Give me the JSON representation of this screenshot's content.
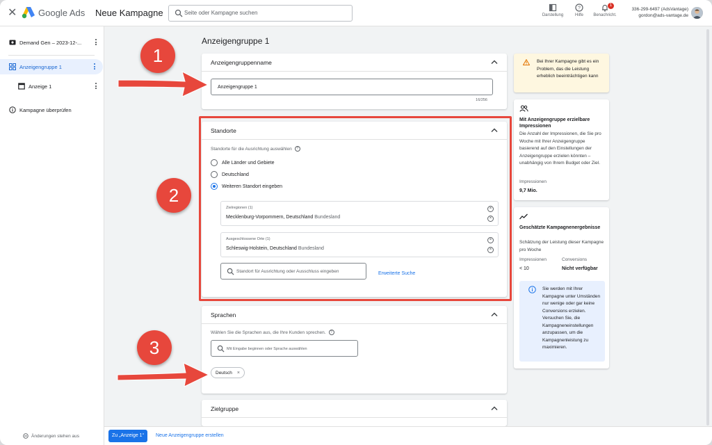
{
  "header": {
    "brand": "Google Ads",
    "title": "Neue Kampagne",
    "search_placeholder": "Seite oder Kampagne suchen",
    "icons": [
      {
        "name": "appearance-icon",
        "label": "Darstellung"
      },
      {
        "name": "help-icon",
        "label": "Hilfe"
      },
      {
        "name": "notifications-icon",
        "label": "Benachricht.",
        "badge": "1"
      }
    ],
    "account": {
      "line1": "336-299-6497 (AdsVantage)",
      "line2": "gordon@ads-vantage.de"
    }
  },
  "sidebar": {
    "items": [
      {
        "label": "Demand Gen – 2023-12-...",
        "icon": "campaign-icon"
      },
      {
        "label": "Anzeigengruppe 1",
        "icon": "grid-icon",
        "active": true
      },
      {
        "label": "Anzeige 1",
        "icon": "ad-icon"
      },
      {
        "label": "Kampagne überprüfen",
        "icon": "info-icon"
      }
    ],
    "footer": "Änderungen stehen aus"
  },
  "main": {
    "page_title": "Anzeigengruppe 1",
    "name_card": {
      "title": "Anzeigengruppenname",
      "value": "Anzeigengruppe 1",
      "counter": "16/256"
    },
    "locations_card": {
      "title": "Standorte",
      "label": "Standorte für die Ausrichtung auswählen",
      "options": [
        "Alle Länder und Gebiete",
        "Deutschland",
        "Weiteren Standort eingeben"
      ],
      "selected": 2,
      "target": {
        "caption": "Zielregionen (1)",
        "value": "Mecklenburg-Vorpommern, Deutschland",
        "type": "Bundesland"
      },
      "excluded": {
        "caption": "Ausgeschlossene Orte (1)",
        "value": "Schleswig-Holstein, Deutschland",
        "type": "Bundesland"
      },
      "search_placeholder": "Standort für Ausrichtung oder Ausschluss eingeben",
      "advanced_link": "Erweiterte Suche"
    },
    "languages_card": {
      "title": "Sprachen",
      "label": "Wählen Sie die Sprachen aus, die Ihre Kunden sprechen.",
      "search_placeholder": "Mit Eingabe beginnen oder Sprache auswählen",
      "chip": "Deutsch"
    },
    "audience_card": {
      "title": "Zielgruppe"
    }
  },
  "right_panel": {
    "warning": "Bei Ihrer Kampagne gibt es ein Problem, das die Leistung erheblich beeinträchtigen kann",
    "impressions_card": {
      "title": "Mit Anzeigengruppe erzielbare Impressionen",
      "text": "Die Anzahl der Impressionen, die Sie pro Woche mit Ihrer Anzeigengruppe basierend auf den Einstellungen der Anzeigengruppe erzielen könnten – unabhängig von Ihrem Budget oder Ziel.",
      "metric_label": "Impressionen",
      "metric_value": "9,7 Mio."
    },
    "results_card": {
      "title": "Geschätzte Kampagnenergebnisse",
      "text": "Schätzung der Leistung dieser Kampagne pro Woche",
      "impr_label": "Impressionen",
      "impr_value": "< 10",
      "conv_label": "Conversions",
      "conv_value": "Nicht verfügbar",
      "info": "Sie werden mit Ihrer Kampagne unter Umständen nur wenige oder gar keine Conversions erzielen. Versuchen Sie, die Kampagneneinstellungen anzupassen, um die Kampagnenleistung zu maximieren."
    }
  },
  "bottom": {
    "primary": "Zu „Anzeige 1“",
    "secondary": "Neue Anzeigengruppe erstellen"
  },
  "annotations": {
    "badges": [
      "1",
      "2",
      "3"
    ],
    "color": "#e7473c"
  },
  "colors": {
    "accent": "#1a73e8",
    "warning_bg": "#fef7e0"
  }
}
